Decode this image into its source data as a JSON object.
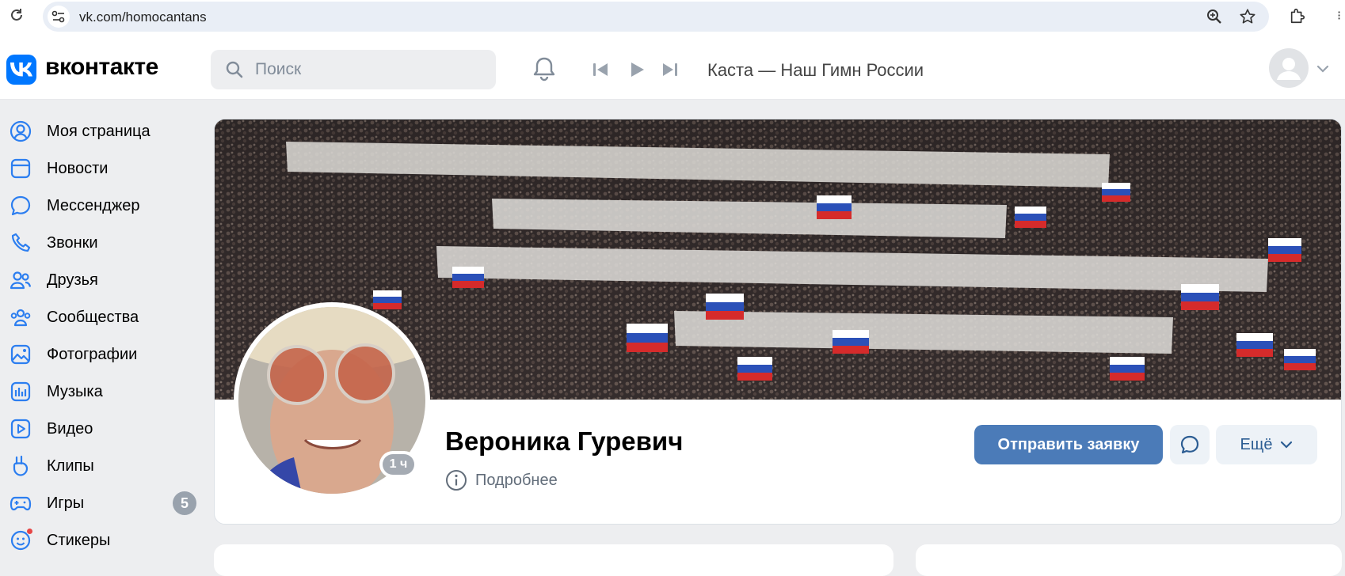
{
  "browser": {
    "url": "vk.com/homocantans"
  },
  "header": {
    "brand": "вконтакте",
    "search_placeholder": "Поиск",
    "now_playing": "Каста — Наш Гимн России"
  },
  "sidebar": {
    "items": [
      {
        "label": "Моя страница",
        "icon": "user-circle-icon"
      },
      {
        "label": "Новости",
        "icon": "news-icon"
      },
      {
        "label": "Мессенджер",
        "icon": "message-icon"
      },
      {
        "label": "Звонки",
        "icon": "phone-icon"
      },
      {
        "label": "Друзья",
        "icon": "friends-icon"
      },
      {
        "label": "Сообщества",
        "icon": "communities-icon"
      },
      {
        "label": "Фотографии",
        "icon": "photo-icon"
      },
      {
        "label": "Музыка",
        "icon": "music-icon"
      },
      {
        "label": "Видео",
        "icon": "video-icon"
      },
      {
        "label": "Клипы",
        "icon": "clips-icon"
      },
      {
        "label": "Игры",
        "icon": "games-icon",
        "badge": "5"
      },
      {
        "label": "Стикеры",
        "icon": "stickers-icon"
      }
    ]
  },
  "profile": {
    "name": "Вероника Гуревич",
    "last_seen": "1 ч",
    "details_label": "Подробнее",
    "add_friend_label": "Отправить заявку",
    "more_label": "Ещё"
  },
  "colors": {
    "vk_blue": "#0077ff",
    "primary_button": "#4b7bb8",
    "secondary_text": "#626d7a",
    "page_bg": "#edeef0"
  }
}
